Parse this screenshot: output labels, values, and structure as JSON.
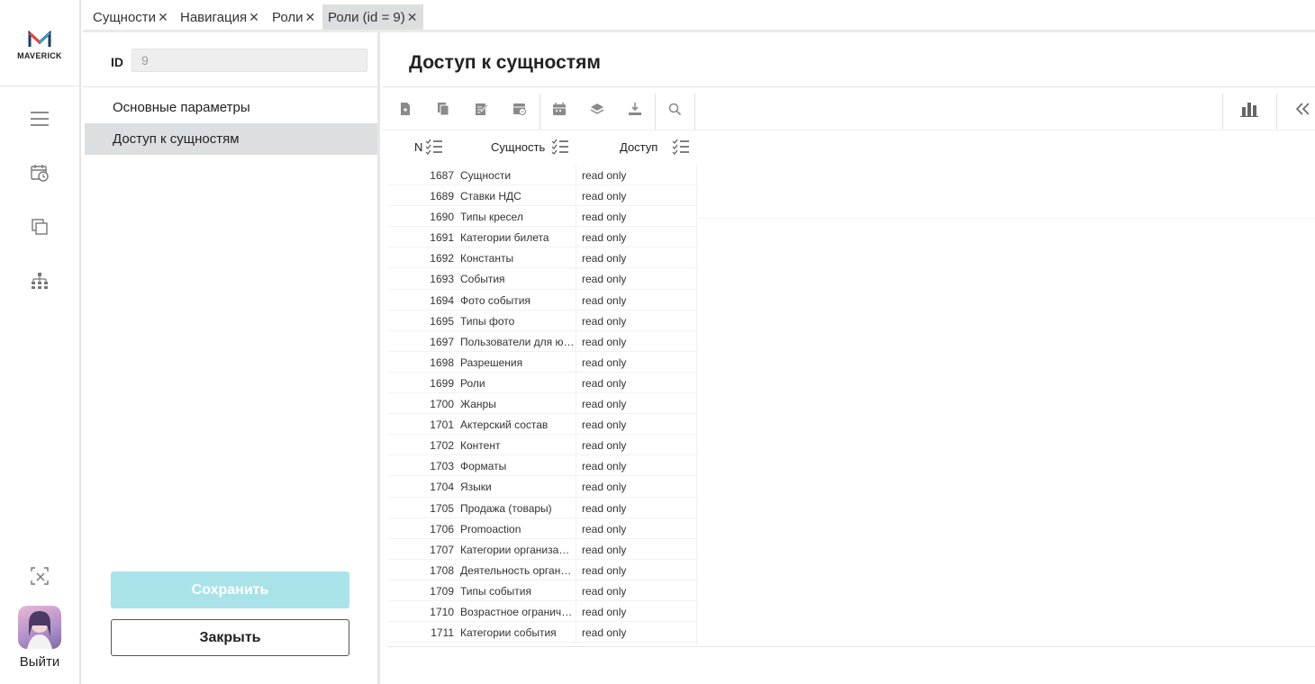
{
  "brand": {
    "logo_text": "MAVERICK"
  },
  "sidebar": {
    "icons": [
      "menu-icon",
      "calendar-clock-icon",
      "copy-icon",
      "hierarchy-icon",
      "close-selection-icon"
    ],
    "logout_label": "Выйти"
  },
  "tabs": [
    {
      "label": "Сущности",
      "active": false
    },
    {
      "label": "Навигация",
      "active": false
    },
    {
      "label": "Роли",
      "active": false
    },
    {
      "label": "Роли (id = 9)",
      "active": true
    }
  ],
  "form": {
    "id_label": "ID",
    "id_value": "9",
    "sections": [
      {
        "label": "Основные параметры",
        "active": false
      },
      {
        "label": "Доступ к сущностям",
        "active": true
      }
    ],
    "save_label": "Сохранить",
    "close_label": "Закрыть"
  },
  "main": {
    "title": "Доступ к сущностям",
    "toolbar_icons": [
      "new-doc-icon",
      "copy-doc-icon",
      "edit-icon",
      "archive-icon",
      "calendar-icon",
      "layers-icon",
      "download-icon",
      "search-icon",
      "chart-icon",
      "collapse-icon"
    ]
  },
  "grid": {
    "columns": {
      "n": "N",
      "entity": "Сущность",
      "access": "Доступ"
    },
    "rows": [
      {
        "n": "1687",
        "entity": "Сущности",
        "access": "read only"
      },
      {
        "n": "1689",
        "entity": "Ставки НДС",
        "access": "read only"
      },
      {
        "n": "1690",
        "entity": "Типы кресел",
        "access": "read only"
      },
      {
        "n": "1691",
        "entity": "Категории билета",
        "access": "read only"
      },
      {
        "n": "1692",
        "entity": "Константы",
        "access": "read only"
      },
      {
        "n": "1693",
        "entity": "События",
        "access": "read only"
      },
      {
        "n": "1694",
        "entity": "Фото события",
        "access": "read only"
      },
      {
        "n": "1695",
        "entity": "Типы фото",
        "access": "read only"
      },
      {
        "n": "1697",
        "entity": "Пользователи для юз...",
        "access": "read only"
      },
      {
        "n": "1698",
        "entity": "Разрешения",
        "access": "read only"
      },
      {
        "n": "1699",
        "entity": "Роли",
        "access": "read only"
      },
      {
        "n": "1700",
        "entity": "Жанры",
        "access": "read only"
      },
      {
        "n": "1701",
        "entity": "Актерский состав",
        "access": "read only"
      },
      {
        "n": "1702",
        "entity": "Контент",
        "access": "read only"
      },
      {
        "n": "1703",
        "entity": "Форматы",
        "access": "read only"
      },
      {
        "n": "1704",
        "entity": "Языки",
        "access": "read only"
      },
      {
        "n": "1705",
        "entity": "Продажа (товары)",
        "access": "read only"
      },
      {
        "n": "1706",
        "entity": "Promoaction",
        "access": "read only"
      },
      {
        "n": "1707",
        "entity": "Категории организаций",
        "access": "read only"
      },
      {
        "n": "1708",
        "entity": "Деятельность органи...",
        "access": "read only"
      },
      {
        "n": "1709",
        "entity": "Типы события",
        "access": "read only"
      },
      {
        "n": "1710",
        "entity": "Возрастное ограниче...",
        "access": "read only"
      },
      {
        "n": "1711",
        "entity": "Категории события",
        "access": "read only"
      }
    ]
  }
}
